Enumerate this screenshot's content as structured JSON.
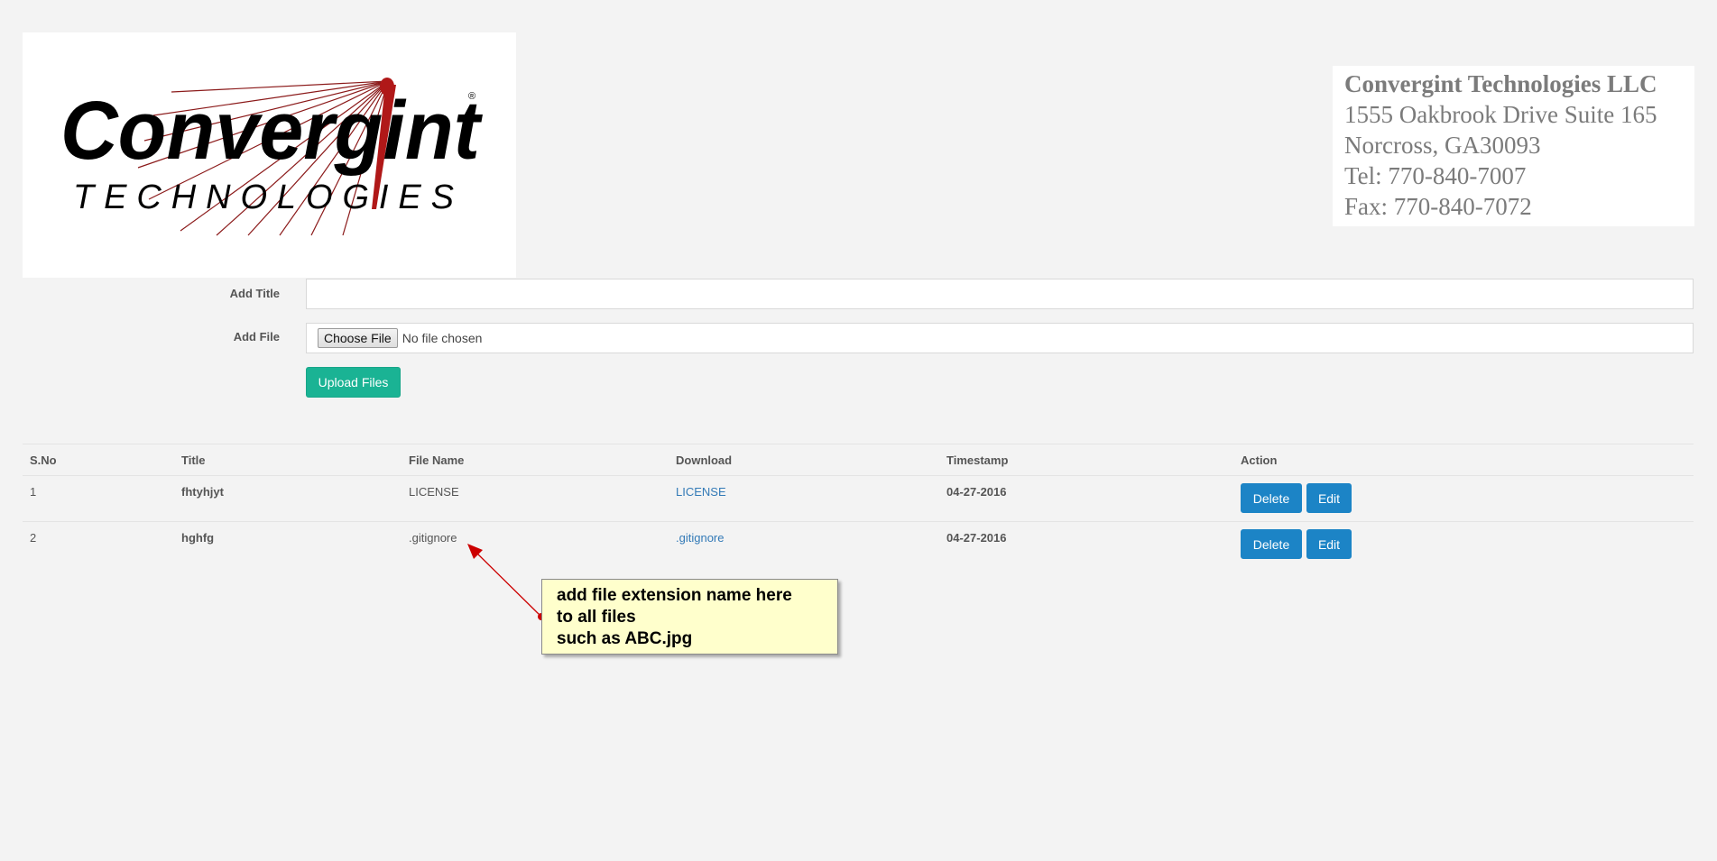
{
  "logo": {
    "wordmark": "Convergint",
    "subtitle": "TECHNOLOGIES",
    "registered": "®"
  },
  "company": {
    "name": "Convergint Technologies LLC",
    "address_line1": "1555 Oakbrook Drive Suite 165",
    "address_line2": "Norcross, GA30093",
    "tel": "Tel: 770-840-7007",
    "fax": "Fax: 770-840-7072"
  },
  "form": {
    "title_label": "Add Title",
    "title_value": "",
    "file_label": "Add File",
    "choose_file_label": "Choose File",
    "no_file_text": "No file chosen",
    "upload_label": "Upload Files"
  },
  "table": {
    "headers": [
      "S.No",
      "Title",
      "File Name",
      "Download",
      "Timestamp",
      "Action"
    ],
    "rows": [
      {
        "sno": "1",
        "title": "fhtyhjyt",
        "file_name": "LICENSE",
        "download": "LICENSE",
        "timestamp": "04-27-2016",
        "delete": "Delete",
        "edit": "Edit"
      },
      {
        "sno": "2",
        "title": "hghfg",
        "file_name": ".gitignore",
        "download": ".gitignore",
        "timestamp": "04-27-2016",
        "delete": "Delete",
        "edit": "Edit"
      }
    ]
  },
  "annotation": {
    "line1": "add file extension name here",
    "line2": "to all files",
    "line3": "such as ABC.jpg"
  },
  "colors": {
    "background": "#f3f3f3",
    "upload_button": "#1ab394",
    "action_button": "#1c84c6",
    "link": "#337ab7",
    "callout_fill": "#ffffcc",
    "arrow": "#cc0000"
  }
}
